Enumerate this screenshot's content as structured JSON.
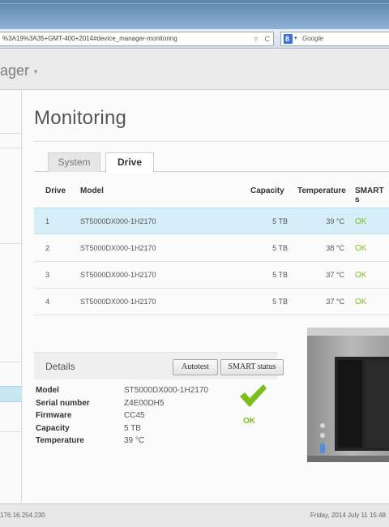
{
  "browser": {
    "url": "%3A19%3A35+GMT-400+2014#device_manager-monitoring",
    "reload_glyph": "C",
    "dropdown_glyph": "▿",
    "search_placeholder": "Google"
  },
  "app": {
    "title": "ager"
  },
  "page": {
    "title": "Monitoring",
    "tabs": [
      {
        "label": "System",
        "active": false
      },
      {
        "label": "Drive",
        "active": true
      }
    ]
  },
  "drive_table": {
    "headers": {
      "drive": "Drive",
      "model": "Model",
      "capacity": "Capacity",
      "temperature": "Temperature",
      "smart": "SMART s"
    },
    "rows": [
      {
        "drive": "1",
        "model": "ST5000DX000-1H2170",
        "capacity": "5 TB",
        "temperature": "39 °C",
        "smart": "OK",
        "selected": true
      },
      {
        "drive": "2",
        "model": "ST5000DX000-1H2170",
        "capacity": "5 TB",
        "temperature": "38 °C",
        "smart": "OK",
        "selected": false
      },
      {
        "drive": "3",
        "model": "ST5000DX000-1H2170",
        "capacity": "5 TB",
        "temperature": "37 °C",
        "smart": "OK",
        "selected": false
      },
      {
        "drive": "4",
        "model": "ST5000DX000-1H2170",
        "capacity": "5 TB",
        "temperature": "37 °C",
        "smart": "OK",
        "selected": false
      }
    ]
  },
  "details": {
    "title": "Details",
    "autotest_label": "Autotest",
    "smart_status_label": "SMART status",
    "fields": [
      {
        "label": "Model",
        "value": "ST5000DX000-1H2170"
      },
      {
        "label": "Serial number",
        "value": "Z4E00DH5"
      },
      {
        "label": "Firmware",
        "value": "CC45"
      },
      {
        "label": "Capacity",
        "value": "5 TB"
      },
      {
        "label": "Temperature",
        "value": "39 °C"
      }
    ],
    "status": "OK",
    "status_icon": "check-icon"
  },
  "statusbar": {
    "ip": "176.16.254.230",
    "datetime": "Friday, 2014 July 11  15:48"
  },
  "colors": {
    "ok_green": "#7cbf1c",
    "selected_row": "#d6eef8"
  }
}
